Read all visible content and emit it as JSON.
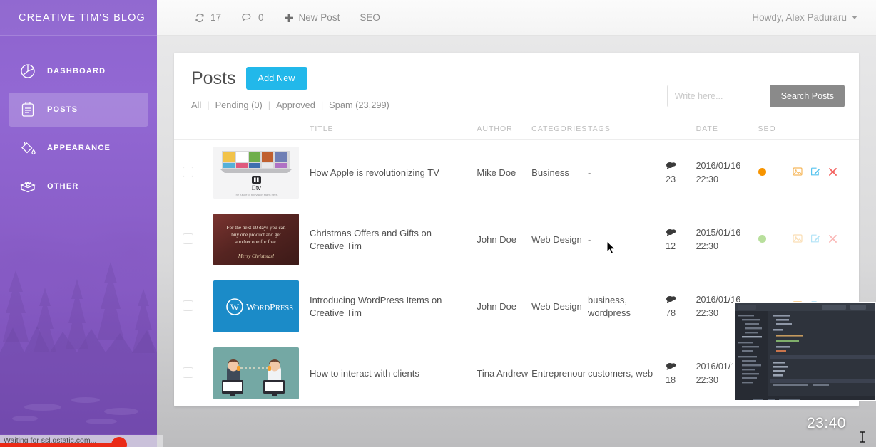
{
  "sidebar": {
    "brand": "CREATIVE TIM'S BLOG",
    "items": [
      {
        "label": "DASHBOARD",
        "icon": "pie-chart-icon",
        "active": false
      },
      {
        "label": "POSTS",
        "icon": "clipboard-icon",
        "active": true
      },
      {
        "label": "APPEARANCE",
        "icon": "paint-bucket-icon",
        "active": false
      },
      {
        "label": "OTHER",
        "icon": "box-icon",
        "active": false
      }
    ]
  },
  "topbar": {
    "updates_count": "17",
    "updates_icon": "refresh-icon",
    "comments_count": "0",
    "comments_icon": "comment-bubble-icon",
    "new_post_label": "New Post",
    "new_post_icon": "plus-icon",
    "seo_label": "SEO",
    "account_label": "Howdy, Alex Paduraru",
    "account_caret_icon": "chevron-down-icon"
  },
  "page": {
    "title": "Posts",
    "add_new_label": "Add New",
    "accent_color": "#22b8ea",
    "filters": [
      {
        "label": "All"
      },
      {
        "label": "Pending (0)"
      },
      {
        "label": "Approved"
      },
      {
        "label": "Spam (23,299)"
      }
    ],
    "filter_separator": "|",
    "search": {
      "placeholder": "Write here...",
      "value": "",
      "button_label": "Search Posts"
    },
    "table": {
      "headers": [
        "",
        "",
        "TITLE",
        "AUTHOR",
        "CATEGORIES",
        "TAGS",
        "",
        "DATE",
        "SEO",
        ""
      ],
      "rows": [
        {
          "thumb": "apple-tv-thumbnail",
          "title": "How Apple is revolutionizing TV",
          "author": "Mike Doe",
          "category": "Business",
          "tags": "-",
          "comments": "23",
          "comments_icon": "comment-bubble-icon",
          "date_day": "2016/01/16",
          "date_time": "22:30",
          "seo_color": "#f79400",
          "actions": [
            "image-icon",
            "edit-icon",
            "delete-icon"
          ],
          "dimmed": false
        },
        {
          "thumb": "christmas-offer-thumbnail",
          "title": "Christmas Offers and Gifts on Creative Tim",
          "author": "John Doe",
          "category": "Web Design",
          "tags": "-",
          "comments": "12",
          "comments_icon": "comment-bubble-icon",
          "date_day": "2015/01/16",
          "date_time": "22:30",
          "seo_color": "#62b924",
          "actions": [
            "image-icon",
            "edit-icon",
            "delete-icon"
          ],
          "dimmed": true
        },
        {
          "thumb": "wordpress-thumbnail",
          "title": "Introducing WordPress Items on Creative Tim",
          "author": "John Doe",
          "category": "Web Design",
          "tags": "business, wordpress",
          "comments": "78",
          "comments_icon": "comment-bubble-icon",
          "date_day": "2016/01/16",
          "date_time": "22:30",
          "seo_color": "#62b924",
          "actions": [
            "image-icon",
            "edit-icon",
            "delete-icon"
          ],
          "dimmed": false
        },
        {
          "thumb": "clients-call-thumbnail",
          "title": "How to interact with clients",
          "author": "Tina Andrew",
          "category": "Entreprenour",
          "tags": "customers, web",
          "comments": "18",
          "comments_icon": "comment-bubble-icon",
          "date_day": "2016/01/16",
          "date_time": "22:30",
          "seo_color": "#62b924",
          "actions": [
            "image-icon",
            "edit-icon",
            "delete-icon"
          ],
          "dimmed": false
        }
      ]
    }
  },
  "overlay": {
    "video_timecode": "23:40",
    "pip_label": "code-editor-video-thumbnail"
  },
  "browser": {
    "status_text": "Waiting for ssl.gstatic.com..."
  }
}
